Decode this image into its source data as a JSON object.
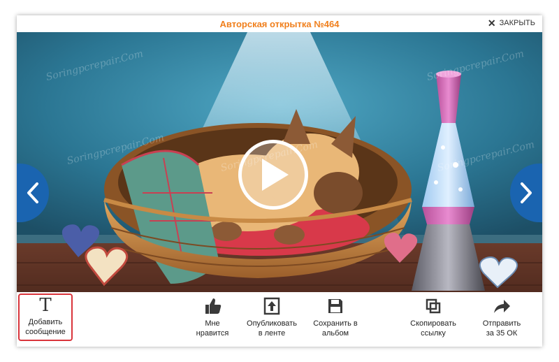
{
  "header": {
    "title": "Авторская открытка №464",
    "close_label": "ЗАКРЫТЬ"
  },
  "scene": {
    "watermark_text": "Soringpcrepair.Com",
    "accent_color": "#1a64b0"
  },
  "toolbar": {
    "add_message": "Добавить\nсообщение",
    "like": "Мне\nнравится",
    "publish": "Опубликовать\nв ленте",
    "save": "Сохранить в\nальбом",
    "copy_link": "Скопировать\nссылку",
    "send": "Отправить\nза 35 ОК"
  },
  "colors": {
    "title": "#f07f1c",
    "highlight_border": "#d9343b"
  }
}
